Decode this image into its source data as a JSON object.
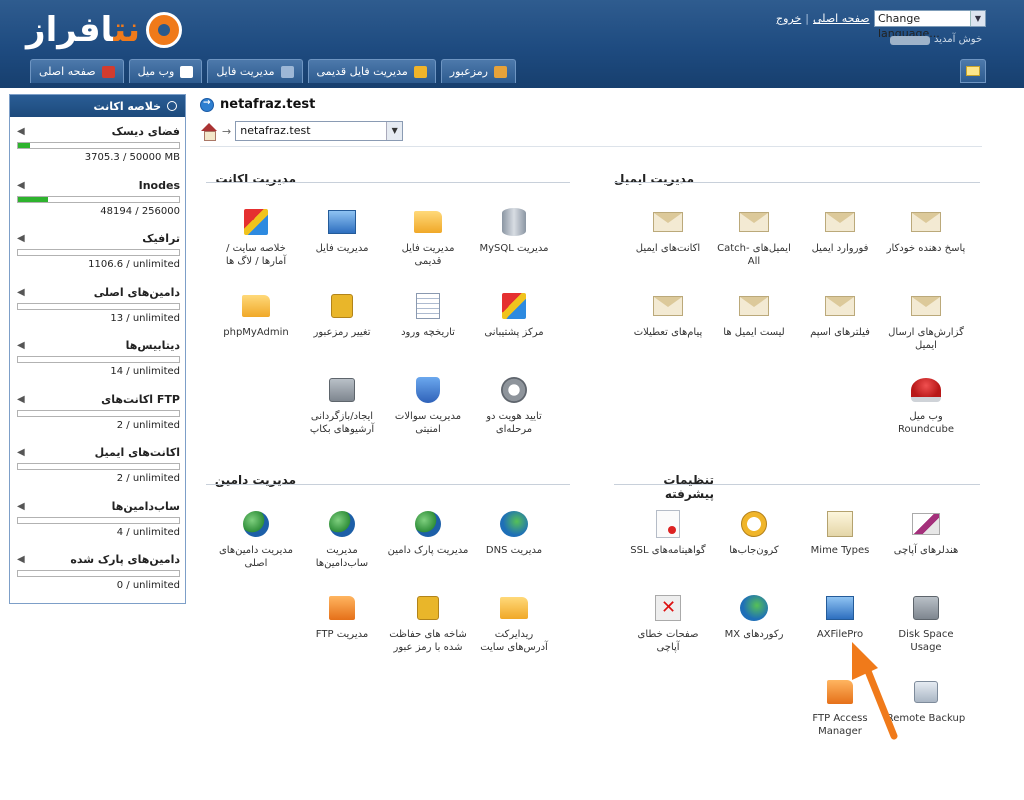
{
  "header": {
    "logo_text_a": "نت",
    "logo_text_b": "افراز",
    "link_home": "صفحه اصلی",
    "link_sep": "|",
    "link_logout": "خروج",
    "language_label": "Change language...",
    "welcome": "خوش آمدید"
  },
  "tabs": [
    {
      "label": "صفحه اصلی",
      "icon": "home-icon",
      "color": "#d23c2f"
    },
    {
      "label": "وب میل",
      "icon": "mail-icon",
      "color": "#ffffff"
    },
    {
      "label": "مدیریت فایل",
      "icon": "files-icon",
      "color": "#9db7d6"
    },
    {
      "label": "مدیریت فایل قدیمی",
      "icon": "folder-icon",
      "color": "#f0b429"
    },
    {
      "label": "رمزعبور",
      "icon": "key-icon",
      "color": "#e6a23a"
    }
  ],
  "sidebar": {
    "title": "خلاصه اکانت",
    "stats": [
      {
        "label": "فضای دیسک",
        "value": "3705.3 / 50000 MB",
        "usage": 0.074
      },
      {
        "label": "Inodes",
        "value": "48194 / 256000",
        "usage": 0.188
      },
      {
        "label": "ترافیک",
        "value": "1106.6 / unlimited",
        "usage": 0
      },
      {
        "label": "دامین‌های اصلی",
        "value": "13 / unlimited",
        "usage": 0
      },
      {
        "label": "دیتابیس‌ها",
        "value": "14 / unlimited",
        "usage": 0
      },
      {
        "label": "اکانت‌های FTP",
        "value": "2 / unlimited",
        "usage": 0
      },
      {
        "label": "اکانت‌های ایمیل",
        "value": "2 / unlimited",
        "usage": 0
      },
      {
        "label": "ساب‌دامین‌ها",
        "value": "4 / unlimited",
        "usage": 0
      },
      {
        "label": "دامین‌های پارک شده",
        "value": "0 / unlimited",
        "usage": 0
      }
    ]
  },
  "main": {
    "domain": "netafraz.test",
    "domain_select": "netafraz.test",
    "crumb_arrow": "→"
  },
  "sections": {
    "account": {
      "title": "مدیریت اکانت",
      "items": [
        {
          "label": "مدیریت MySQL",
          "icon": "database-icon"
        },
        {
          "label": "مدیریت فایل قدیمی",
          "icon": "folder-icon"
        },
        {
          "label": "مدیریت فایل",
          "icon": "file-manager-icon"
        },
        {
          "label": "خلاصه سایت / آمارها / لاگ ها",
          "icon": "stats-icon"
        },
        {
          "label": "مرکز پشتیبانی",
          "icon": "support-icon"
        },
        {
          "label": "تاریخچه ورود",
          "icon": "login-history-icon"
        },
        {
          "label": "تغییر رمزعبور",
          "icon": "lock-icon"
        },
        {
          "label": "phpMyAdmin",
          "icon": "phpmyadmin-icon"
        },
        {
          "label": "تایید هویت دو مرحله‌ای",
          "icon": "two-factor-icon"
        },
        {
          "label": "مدیریت سوالات امنیتی",
          "icon": "security-question-icon"
        },
        {
          "label": "ایجاد/بازگردانی آرشیوهای بکاپ",
          "icon": "backup-icon"
        }
      ]
    },
    "email": {
      "title": "مدیریت ایمیل",
      "items": [
        {
          "label": "پاسخ دهنده خودکار",
          "icon": "autoresponder-icon"
        },
        {
          "label": "فوروارد ایمیل",
          "icon": "forward-icon"
        },
        {
          "label": "ایمیل‌های Catch-All",
          "icon": "catch-all-icon"
        },
        {
          "label": "اکانت‌های ایمیل",
          "icon": "email-accounts-icon"
        },
        {
          "label": "گزارش‌های ارسال ایمیل",
          "icon": "delivery-report-icon"
        },
        {
          "label": "فیلترهای اسپم",
          "icon": "spam-filter-icon"
        },
        {
          "label": "لیست ایمیل ها",
          "icon": "mailing-list-icon"
        },
        {
          "label": "پیام‌های تعطیلات",
          "icon": "vacation-icon"
        },
        {
          "label": "وب میل Roundcube",
          "icon": "roundcube-icon"
        }
      ]
    },
    "domain": {
      "title": "مدیریت دامین",
      "items": [
        {
          "label": "مدیریت DNS",
          "icon": "dns-icon"
        },
        {
          "label": "مدیریت پارک دامین",
          "icon": "park-domain-icon"
        },
        {
          "label": "مدیریت ساب‌دامین‌ها",
          "icon": "subdomain-icon"
        },
        {
          "label": "مدیریت دامین‌های اصلی",
          "icon": "domain-icon"
        },
        {
          "label": "ریدایرکت آدرس‌های سایت",
          "icon": "redirect-icon"
        },
        {
          "label": "شاخه های حفاظت شده با رمز عبور",
          "icon": "protected-dir-icon"
        },
        {
          "label": "مدیریت FTP",
          "icon": "ftp-icon"
        }
      ]
    },
    "advanced": {
      "title": "تنظیمات پیشرفته",
      "items": [
        {
          "label": "هندلرهای آپاچی",
          "icon": "apache-handler-icon"
        },
        {
          "label": "Mime Types",
          "icon": "mime-icon"
        },
        {
          "label": "کرون‌جاب‌ها",
          "icon": "cron-icon"
        },
        {
          "label": "گواهینامه‌های SSL",
          "icon": "ssl-icon"
        },
        {
          "label": "Disk Space Usage",
          "icon": "disk-icon"
        },
        {
          "label": "AXFilePro",
          "icon": "axfilepro-icon"
        },
        {
          "label": "رکوردهای MX",
          "icon": "mx-icon"
        },
        {
          "label": "صفحات خطای آپاچی",
          "icon": "error-page-icon"
        },
        {
          "label": "Remote Backup",
          "icon": "remote-backup-icon"
        },
        {
          "label": "FTP Access Manager",
          "icon": "ftp-access-icon"
        }
      ]
    }
  },
  "annotation": {
    "color": "#f07a1a"
  }
}
